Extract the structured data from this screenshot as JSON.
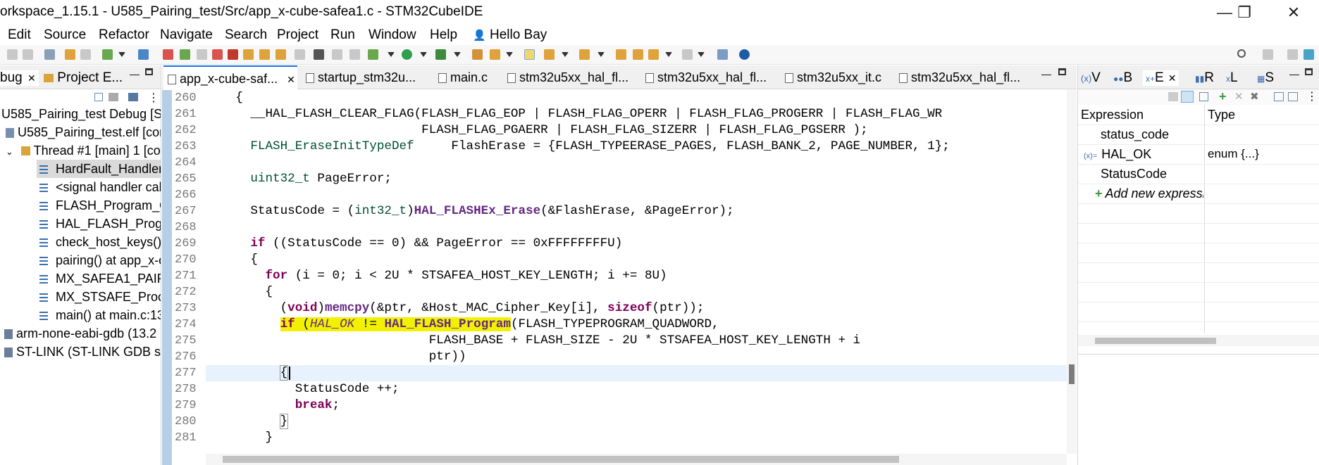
{
  "window": {
    "title": "orkspace_1.15.1 - U585_Pairing_test/Src/app_x-cube-safea1.c - STM32CubeIDE",
    "minimize_label": "—",
    "restore_label": "❐",
    "close_label": "✕"
  },
  "menu": {
    "items": [
      "Edit",
      "Source",
      "Refactor",
      "Navigate",
      "Search",
      "Project",
      "Run",
      "Window",
      "Help"
    ],
    "user_label": "Hello Bay"
  },
  "left_panel": {
    "tabs": [
      {
        "label": "bug"
      },
      {
        "label": "Project E..."
      }
    ],
    "tree": [
      {
        "label": "U585_Pairing_test Debug [ST"
      },
      {
        "label": "U585_Pairing_test.elf [core"
      },
      {
        "label": "Thread #1 [main] 1 [co"
      },
      {
        "label": "HardFault_Handler("
      },
      {
        "label": "<signal handler call"
      },
      {
        "label": "FLASH_Program_Qu"
      },
      {
        "label": "HAL_FLASH_Progra"
      },
      {
        "label": "check_host_keys() a"
      },
      {
        "label": "pairing() at app_x-c"
      },
      {
        "label": "MX_SAFEA1_PAIRIN"
      },
      {
        "label": "MX_STSAFE_Proces"
      },
      {
        "label": "main() at main.c:13("
      },
      {
        "label": "arm-none-eabi-gdb (13.2"
      },
      {
        "label": "ST-LINK (ST-LINK GDB ser"
      }
    ]
  },
  "editor": {
    "tabs": [
      {
        "label": "app_x-cube-saf..."
      },
      {
        "label": "startup_stm32u..."
      },
      {
        "label": "main.c"
      },
      {
        "label": "stm32u5xx_hal_fl..."
      },
      {
        "label": "stm32u5xx_hal_fl..."
      },
      {
        "label": "stm32u5xx_it.c"
      },
      {
        "label": "stm32u5xx_hal_fl..."
      }
    ],
    "line_numbers": [
      "260",
      "261",
      "262",
      "263",
      "264",
      "265",
      "266",
      "267",
      "268",
      "269",
      "270",
      "271",
      "272",
      "273",
      "274",
      "275",
      "276",
      "277",
      "278",
      "279",
      "280",
      "281"
    ],
    "lines": {
      "l260": "    {",
      "l261": "      __HAL_FLASH_CLEAR_FLAG(FLASH_FLAG_EOP | FLASH_FLAG_OPERR | FLASH_FLAG_PROGERR | FLASH_FLAG_WR",
      "l262": "                             FLASH_FLAG_PGAERR | FLASH_FLAG_SIZERR | FLASH_FLAG_PGSERR );",
      "l263_type": "FLASH_EraseInitTypeDef",
      "l263_rest": "     FlashErase = {FLASH_TYPEERASE_PAGES, FLASH_BANK_2, PAGE_NUMBER, 1};",
      "l265_type": "uint32_t",
      "l265_rest": " PageError;",
      "l267_a": "StatusCode = (",
      "l267_type": "int32_t",
      "l267_b": ")",
      "l267_fn": "HAL_FLASHEx_Erase",
      "l267_c": "(&FlashErase, &PageError);",
      "l269_kw": "if",
      "l269_rest": " ((StatusCode == 0) && PageError == 0xFFFFFFFFU)",
      "l270": "{",
      "l271_kw": "for",
      "l271_rest": " (i = 0; i < 2U * STSAFEA_HOST_KEY_LENGTH; i += 8U)",
      "l272": "{",
      "l273_kw1": "void",
      "l273_fn": "memcpy",
      "l273_a": "(&ptr, &Host_MAC_Cipher_Key[i], ",
      "l273_kw2": "sizeof",
      "l273_b": "(ptr));",
      "l274_kw": "if",
      "l274_a": " (",
      "l274_it": "HAL_OK",
      "l274_b": " != ",
      "l274_fn": "HAL_FLASH_Program",
      "l274_c": "(FLASH_TYPEPROGRAM_QUADWORD,",
      "l275": "FLASH_BASE + FLASH_SIZE - 2U * STSAFEA_HOST_KEY_LENGTH + i",
      "l276": "ptr))",
      "l277": "{",
      "l278": "StatusCode ++;",
      "l279_kw": "break",
      "l279_rest": ";",
      "l280": "}",
      "l281": "}"
    }
  },
  "right_panel": {
    "tabs": [
      {
        "label": "V"
      },
      {
        "label": "B"
      },
      {
        "label": "E"
      },
      {
        "label": "R"
      },
      {
        "label": "L"
      },
      {
        "label": "S"
      }
    ],
    "columns": [
      "Expression",
      "Type"
    ],
    "rows": [
      {
        "expression": "status_code",
        "type": ""
      },
      {
        "expression": "HAL_OK",
        "type": "enum {...}"
      },
      {
        "expression": "StatusCode",
        "type": ""
      }
    ],
    "add_label": "Add new expressi"
  },
  "colors": {
    "keyword": "#7f0055",
    "type": "#005032",
    "function": "#642880",
    "highlight": "#f2f200",
    "current_line": "#e8f2fe"
  }
}
